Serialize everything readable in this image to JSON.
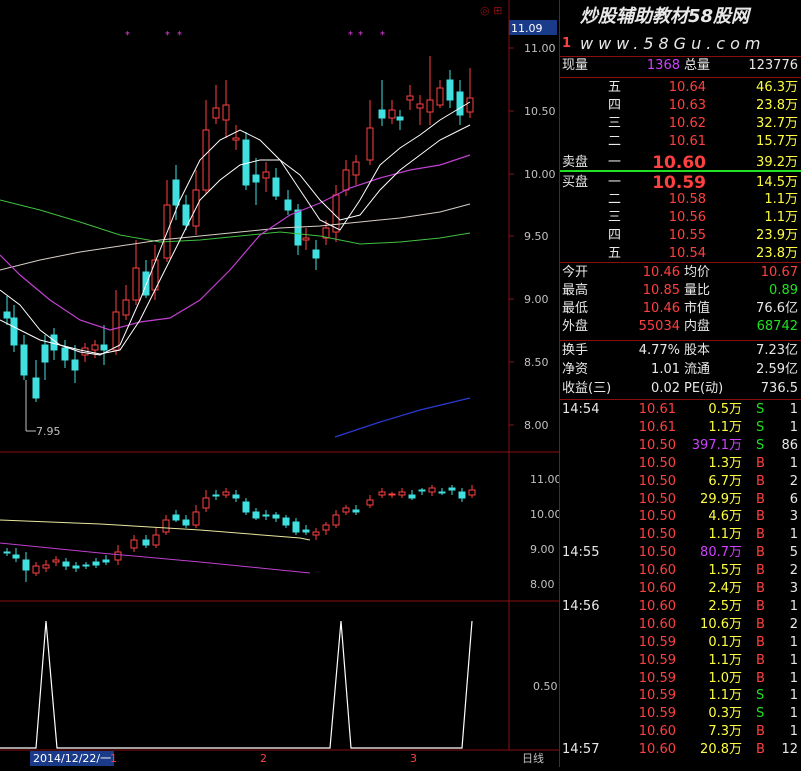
{
  "header": {
    "price_tag": "11.09",
    "brand": "炒股辅助教材58股网",
    "site": "www.58Gu.com",
    "site_prefix": "1"
  },
  "main_axis": [
    "11.00",
    "10.50",
    "10.00",
    "9.50",
    "9.00",
    "8.50",
    "8.00"
  ],
  "low_marker": "7.95",
  "mid_axis": [
    "11.00",
    "10.00",
    "9.00",
    "8.00"
  ],
  "low_axis": [
    "0.50"
  ],
  "bottom_bar": {
    "date": "2014/12/22/一",
    "tick1": "1",
    "tick2": "2",
    "tick3": "3",
    "period": "日线"
  },
  "quote": {
    "xianliang_label": "现量",
    "xianliang": "1368",
    "zongliang_label": "总量",
    "zongliang": "123776",
    "sell": [
      {
        "label": "五",
        "price": "10.64",
        "vol": "46.3万"
      },
      {
        "label": "四",
        "price": "10.63",
        "vol": "23.8万"
      },
      {
        "label": "三",
        "price": "10.62",
        "vol": "32.7万"
      },
      {
        "label": "二",
        "price": "10.61",
        "vol": "15.7万"
      },
      {
        "label": "一",
        "price": "10.60",
        "vol": "39.2万"
      }
    ],
    "sell_title": "卖盘",
    "buy_title": "买盘",
    "buy": [
      {
        "label": "一",
        "price": "10.59",
        "vol": "14.5万"
      },
      {
        "label": "二",
        "price": "10.58",
        "vol": "1.1万"
      },
      {
        "label": "三",
        "price": "10.56",
        "vol": "1.1万"
      },
      {
        "label": "四",
        "price": "10.55",
        "vol": "23.9万"
      },
      {
        "label": "五",
        "price": "10.54",
        "vol": "23.8万"
      }
    ],
    "stats": [
      {
        "l1": "今开",
        "v1": "10.46",
        "l2": "均价",
        "v2": "10.67"
      },
      {
        "l1": "最高",
        "v1": "10.85",
        "l2": "量比",
        "v2": "0.89"
      },
      {
        "l1": "最低",
        "v1": "10.46",
        "l2": "市值",
        "v2": "76.6亿"
      },
      {
        "l1": "外盘",
        "v1": "55034",
        "l2": "内盘",
        "v2": "68742"
      }
    ],
    "fund": [
      {
        "l1": "换手",
        "v1": "4.77%",
        "l2": "股本",
        "v2": "7.23亿"
      },
      {
        "l1": "净资",
        "v1": "1.01",
        "l2": "流通",
        "v2": "2.59亿"
      },
      {
        "l1": "收益(三)",
        "v1": "0.02",
        "l2": "PE(动)",
        "v2": "736.5"
      }
    ],
    "ticks": [
      {
        "time": "14:54",
        "price": "10.61",
        "vol": "0.5万",
        "side": "S",
        "n": "1"
      },
      {
        "time": "",
        "price": "10.61",
        "vol": "1.1万",
        "side": "S",
        "n": "1"
      },
      {
        "time": "",
        "price": "10.50",
        "vol": "397.1万",
        "side": "S",
        "n": "86"
      },
      {
        "time": "",
        "price": "10.50",
        "vol": "1.3万",
        "side": "B",
        "n": "1"
      },
      {
        "time": "",
        "price": "10.50",
        "vol": "6.7万",
        "side": "B",
        "n": "2"
      },
      {
        "time": "",
        "price": "10.50",
        "vol": "29.9万",
        "side": "B",
        "n": "6"
      },
      {
        "time": "",
        "price": "10.50",
        "vol": "4.6万",
        "side": "B",
        "n": "3"
      },
      {
        "time": "",
        "price": "10.50",
        "vol": "1.1万",
        "side": "B",
        "n": "1"
      },
      {
        "time": "14:55",
        "price": "10.50",
        "vol": "80.7万",
        "side": "B",
        "n": "5"
      },
      {
        "time": "",
        "price": "10.60",
        "vol": "1.5万",
        "side": "B",
        "n": "2"
      },
      {
        "time": "",
        "price": "10.60",
        "vol": "2.4万",
        "side": "B",
        "n": "3"
      },
      {
        "time": "14:56",
        "price": "10.60",
        "vol": "2.5万",
        "side": "B",
        "n": "1"
      },
      {
        "time": "",
        "price": "10.60",
        "vol": "10.6万",
        "side": "B",
        "n": "2"
      },
      {
        "time": "",
        "price": "10.59",
        "vol": "0.1万",
        "side": "B",
        "n": "1"
      },
      {
        "time": "",
        "price": "10.59",
        "vol": "1.1万",
        "side": "B",
        "n": "1"
      },
      {
        "time": "",
        "price": "10.59",
        "vol": "1.0万",
        "side": "B",
        "n": "1"
      },
      {
        "time": "",
        "price": "10.59",
        "vol": "1.1万",
        "side": "S",
        "n": "1"
      },
      {
        "time": "",
        "price": "10.59",
        "vol": "0.3万",
        "side": "S",
        "n": "1"
      },
      {
        "time": "",
        "price": "10.60",
        "vol": "7.3万",
        "side": "B",
        "n": "1"
      },
      {
        "time": "14:57",
        "price": "10.60",
        "vol": "20.8万",
        "side": "B",
        "n": "12"
      }
    ]
  }
}
